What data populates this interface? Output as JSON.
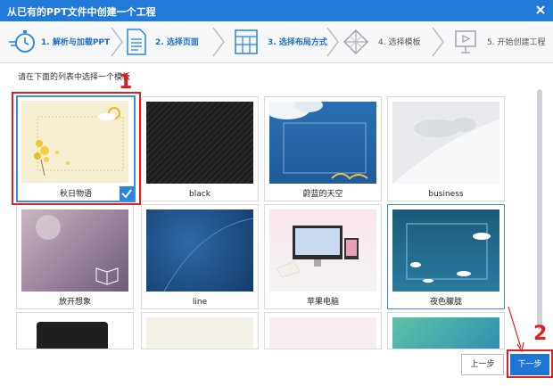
{
  "window": {
    "title": "从已有的PPT文件中创建一个工程",
    "close_icon": "close-icon"
  },
  "steps": [
    {
      "label": "1. 解析与加载PPT",
      "icon": "stopwatch-icon",
      "state": "active"
    },
    {
      "label": "2. 选择页面",
      "icon": "document-icon",
      "state": "active"
    },
    {
      "label": "3. 选择布局方式",
      "icon": "layout-grid-icon",
      "state": "active"
    },
    {
      "label": "4. 选择模板",
      "icon": "diamond-icon",
      "state": "inactive"
    },
    {
      "label": "5. 开始创建工程",
      "icon": "presentation-icon",
      "state": "inactive"
    }
  ],
  "instruction": "请在下面的列表中选择一个模板",
  "templates": [
    {
      "name": "秋日物语",
      "selected": true
    },
    {
      "name": "black",
      "selected": false
    },
    {
      "name": "蔚蓝的天空",
      "selected": false
    },
    {
      "name": "business",
      "selected": false
    },
    {
      "name": "放开想象",
      "selected": false
    },
    {
      "name": "line",
      "selected": false
    },
    {
      "name": "苹果电脑",
      "selected": false
    },
    {
      "name": "夜色朦胧",
      "selected": false,
      "hovered": true
    }
  ],
  "annotations": {
    "marker1": "1",
    "marker2": "2"
  },
  "buttons": {
    "prev": "上一步",
    "next": "下一步"
  },
  "colors": {
    "accent": "#2179d8",
    "annotation": "#e02020"
  }
}
